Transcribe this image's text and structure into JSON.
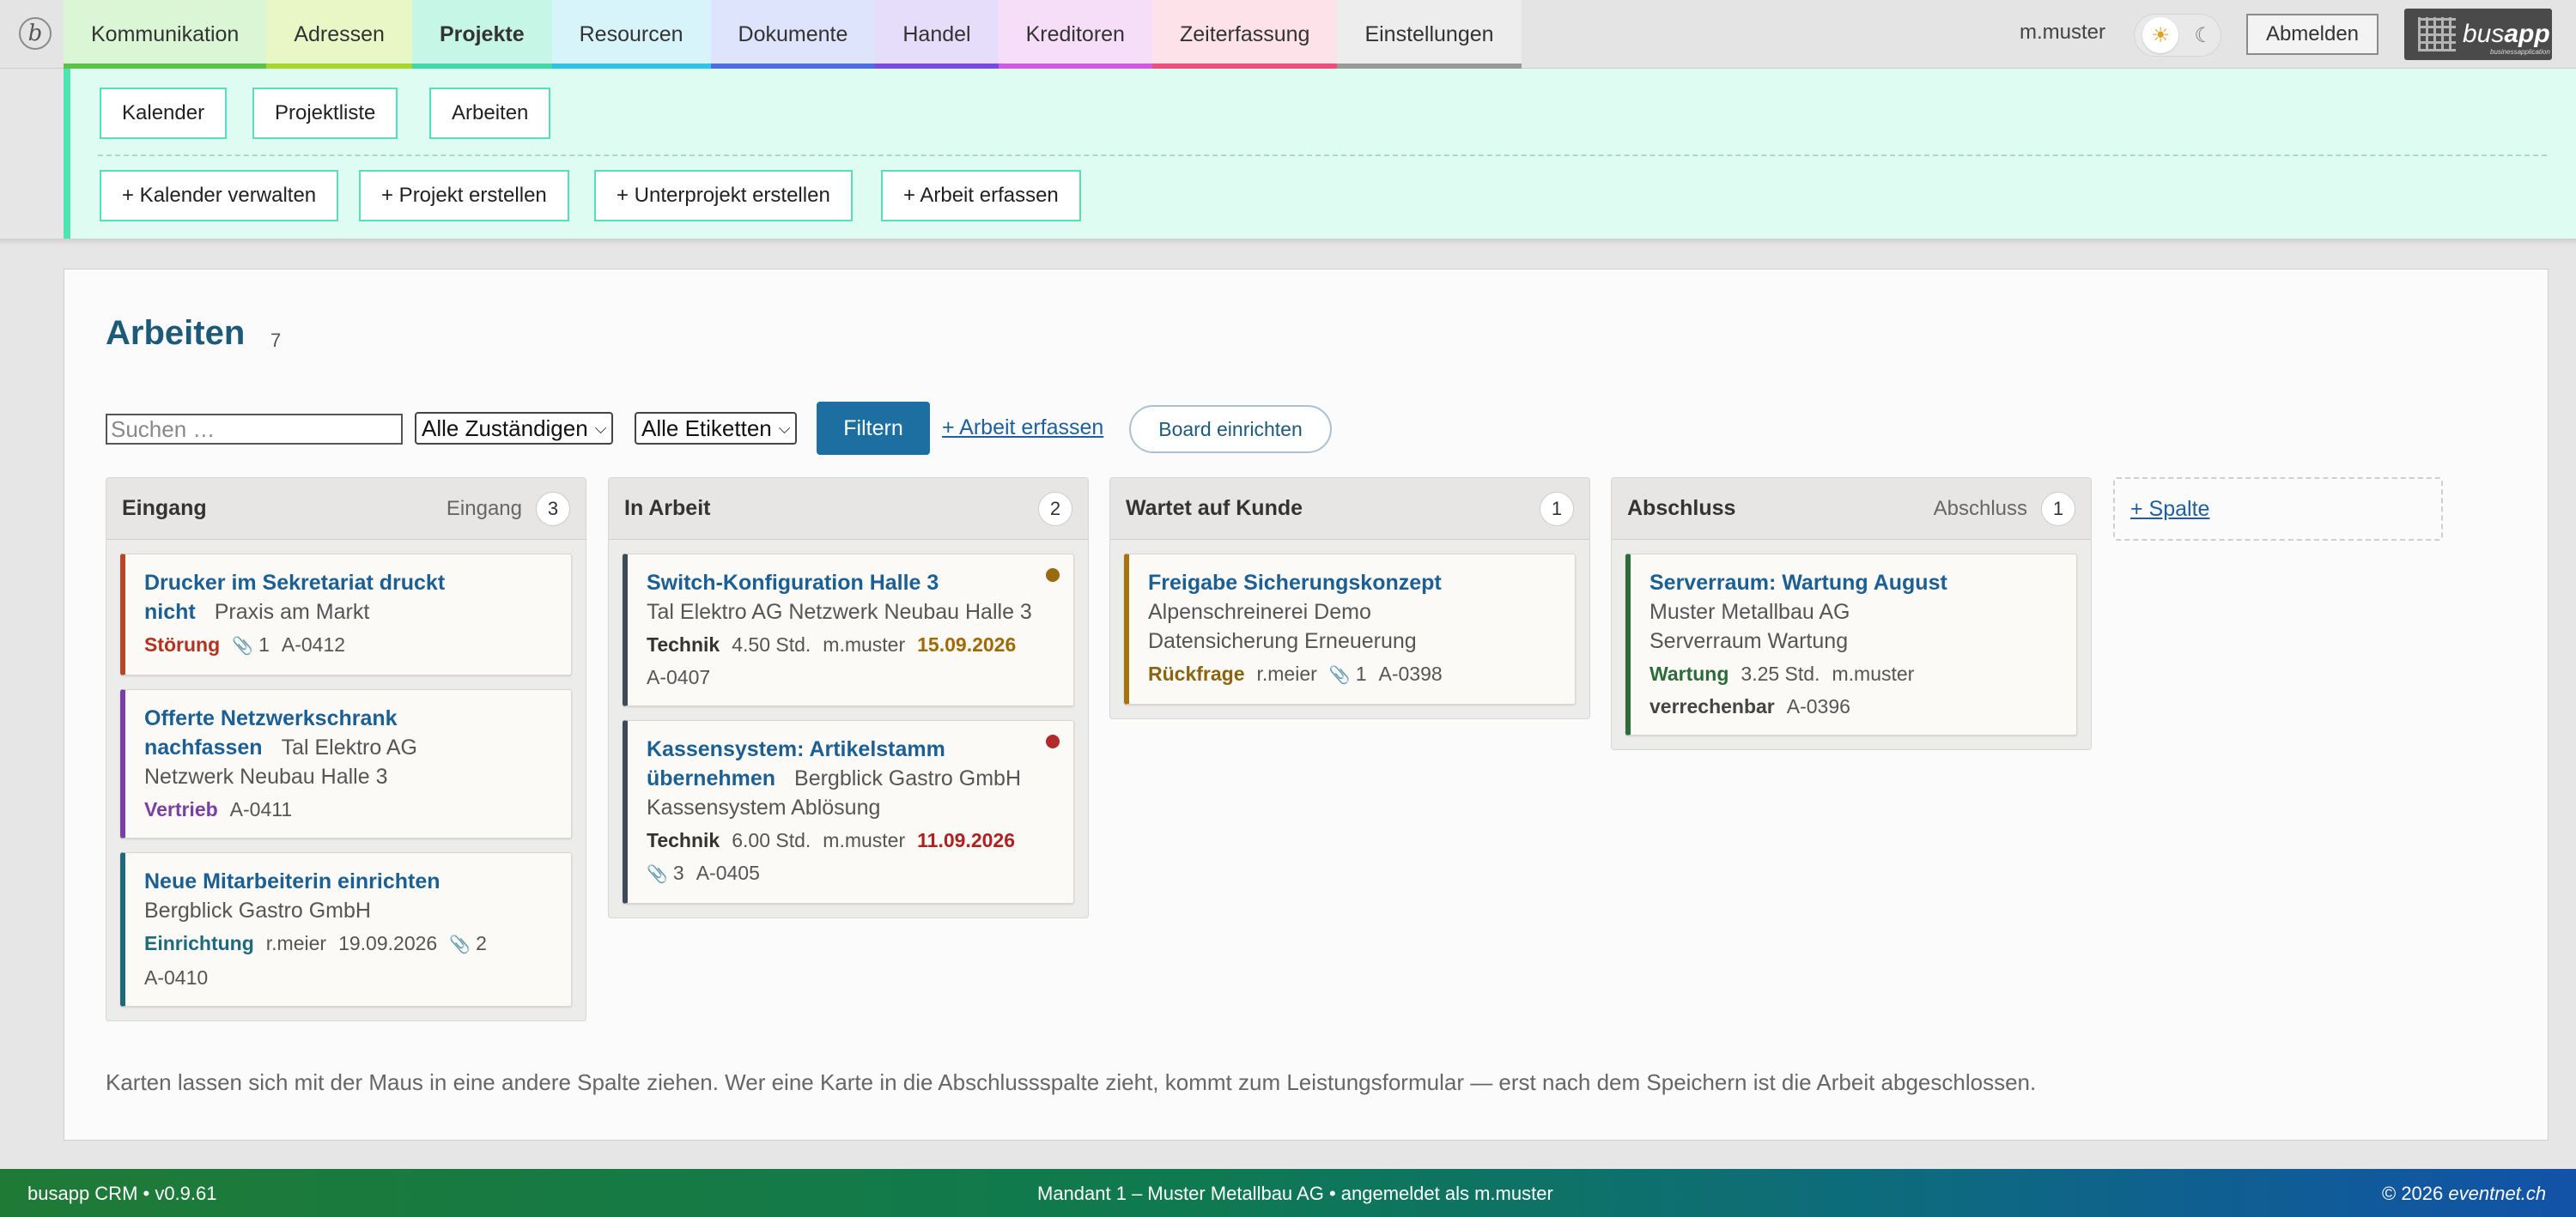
{
  "nav": {
    "tabs": [
      {
        "label": "Kommunikation",
        "bg": "#dbf6d5",
        "line": "#58c24a"
      },
      {
        "label": "Adressen",
        "bg": "#e9f7c7",
        "line": "#a4d62f"
      },
      {
        "label": "Projekte",
        "bg": "#c6f7e6",
        "line": "#3fd8a6",
        "active": true
      },
      {
        "label": "Resourcen",
        "bg": "#d8f4fb",
        "line": "#2fc3e3"
      },
      {
        "label": "Dokumente",
        "bg": "#dde4fb",
        "line": "#4a6fe0"
      },
      {
        "label": "Handel",
        "bg": "#e6ddfb",
        "line": "#7a49e0"
      },
      {
        "label": "Kreditoren",
        "bg": "#f6ddf8",
        "line": "#cf5be0"
      },
      {
        "label": "Zeiterfassung",
        "bg": "#fde2ea",
        "line": "#ec4f7d"
      },
      {
        "label": "Einstellungen",
        "bg": "#ededed",
        "line": "#9a9a9a"
      }
    ],
    "user": "m.muster",
    "logout": "Abmelden",
    "brand_name_light": "bus",
    "brand_name_bold": "app",
    "brand_sub": "businessapplication"
  },
  "subnav": {
    "views": [
      "Kalender",
      "Projektliste",
      "Arbeiten"
    ],
    "actions": [
      "+ Kalender verwalten",
      "+ Projekt erstellen",
      "+ Unterprojekt erstellen",
      "+ Arbeit erfassen"
    ]
  },
  "page": {
    "title": "Arbeiten",
    "count": "7",
    "search_placeholder": "Suchen …",
    "assignee_select": "Alle Zuständigen",
    "label_select": "Alle Etiketten",
    "filter": "Filtern",
    "add_work": "+ Arbeit erfassen",
    "board_setup": "Board einrichten",
    "add_column": "+ Spalte",
    "hint": "Karten lassen sich mit der Maus in eine andere Spalte ziehen. Wer eine Karte in die Abschlussspalte zieht, kommt zum Leistungsformular — erst nach dem Speichern ist die Arbeit abgeschlossen."
  },
  "columns": [
    {
      "title": "Eingang",
      "tag": "Eingang",
      "count": "3",
      "cards": [
        {
          "title": "Drucker im Sekretariat druckt nicht",
          "sub": "Praxis am Markt",
          "sub_inline": true,
          "color": "#b5482b",
          "meta": [
            {
              "label": "Störung",
              "color": "#b3321f"
            },
            {
              "clip": "1"
            },
            {
              "text": "A-0412"
            }
          ]
        },
        {
          "title": "Offerte Netzwerkschrank nachfassen",
          "sub": "Tal Elektro AG",
          "sub_inline": true,
          "sub2": "Netzwerk Neubau Halle 3",
          "color": "#7b3fa3",
          "meta": [
            {
              "label": "Vertrieb",
              "color": "#7b3fa3"
            },
            {
              "text": "A-0411"
            }
          ]
        },
        {
          "title": "Neue Mitarbeiterin einrichten",
          "sub": "Bergblick Gastro GmbH",
          "color": "#1d6a7a",
          "meta": [
            {
              "label": "Einrichtung",
              "color": "#1d6a7a"
            },
            {
              "text": "r.meier"
            },
            {
              "text": "19.09.2026"
            },
            {
              "clip": "2"
            }
          ],
          "meta2": [
            {
              "text": "A-0410"
            }
          ]
        }
      ]
    },
    {
      "title": "In Arbeit",
      "tag": "",
      "count": "2",
      "cards": [
        {
          "title": "Switch-Konfiguration Halle 3",
          "sub": "Tal Elektro AG Netzwerk Neubau Halle 3",
          "color": "#3f4a58",
          "dot": "#9a6a10",
          "meta": [
            {
              "label": "Technik",
              "color": "#333"
            },
            {
              "text": "4.50 Std."
            },
            {
              "text": "m.muster"
            },
            {
              "date": "15.09.2026",
              "color": "#a06a00"
            }
          ],
          "meta2": [
            {
              "text": "A-0407"
            }
          ]
        },
        {
          "title": "Kassensystem: Artikelstamm übernehmen",
          "sub": "Bergblick Gastro GmbH",
          "sub_inline": true,
          "sub2": "Kassensystem Ablösung",
          "color": "#3f4a58",
          "dot": "#b02a2a",
          "meta": [
            {
              "label": "Technik",
              "color": "#333"
            },
            {
              "text": "6.00 Std."
            },
            {
              "text": "m.muster"
            },
            {
              "date": "11.09.2026",
              "color": "#b02020"
            }
          ],
          "meta2": [
            {
              "clip": "3"
            },
            {
              "text": "A-0405"
            }
          ]
        }
      ]
    },
    {
      "title": "Wartet auf Kunde",
      "tag": "",
      "count": "1",
      "cards": [
        {
          "title": "Freigabe Sicherungskonzept",
          "sub": "Alpenschreinerei Demo",
          "sub2": "Datensicherung Erneuerung",
          "color": "#a8730c",
          "meta": [
            {
              "label": "Rückfrage",
              "color": "#8a6410"
            },
            {
              "text": "r.meier"
            },
            {
              "clip": "1"
            },
            {
              "text": "A-0398"
            }
          ]
        }
      ]
    },
    {
      "title": "Abschluss",
      "tag": "Abschluss",
      "count": "1",
      "cards": [
        {
          "title": "Serverraum: Wartung August",
          "sub": "Muster Metallbau AG",
          "sub2": "Serverraum Wartung",
          "color": "#2e6b3a",
          "meta": [
            {
              "label": "Wartung",
              "color": "#2e6b3a"
            },
            {
              "text": "3.25 Std."
            },
            {
              "text": "m.muster"
            }
          ],
          "meta2": [
            {
              "label": "verrechenbar",
              "color": "#444"
            },
            {
              "text": "A-0396"
            }
          ]
        }
      ]
    }
  ],
  "footer": {
    "left": "busapp CRM • v0.9.61",
    "center": "Mandant 1 – Muster Metallbau AG • angemeldet als m.muster",
    "right_prefix": "© 2026 ",
    "right_brand": "eventnet.ch"
  },
  "icons": {
    "logo": "b-circle-icon",
    "sun": "sun-icon",
    "moon": "moon-icon",
    "attachment": "paperclip-icon",
    "brand": "busapp-logo"
  }
}
